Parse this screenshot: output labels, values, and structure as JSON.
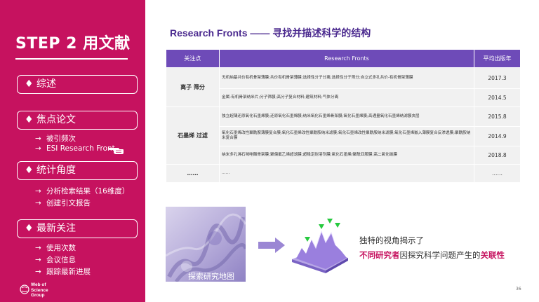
{
  "sidebar": {
    "title": "STEP 2  用文献",
    "sections": [
      {
        "label": "♦ 综述",
        "items": []
      },
      {
        "label": "♦ 焦点论文",
        "items": [
          "被引频次",
          "ESI Research Front"
        ]
      },
      {
        "label": "♦ 统计角度",
        "items": [
          "分析检索结果（16维度）",
          "创建引文报告"
        ]
      },
      {
        "label": "♦ 最新关注",
        "items": [
          "使用次数",
          "会议信息",
          "跟踪最新进展"
        ]
      }
    ],
    "arrow": "→",
    "pointer_icon": "hand-pointer-icon",
    "logo_lines": [
      "Web of",
      "Science",
      "Group"
    ]
  },
  "main": {
    "heading": "Research Fronts —— 寻找并描述科学的结构",
    "table": {
      "headers": [
        "关注点",
        "Research Fronts",
        "平均出版年"
      ],
      "groups": [
        {
          "focus": "离子 筛分",
          "fronts": [
            {
              "text": "无机纳基共价有机骨架薄膜;共价有机骨架薄膜;选择性分子分离;选择性分子筛分;自立式多孔共价-有机骨架薄膜",
              "year": "2017.3"
            },
            {
              "text": "金属-有机骨架纳米片;分子筛膜;高分子复合材料;建筑材料;气体分离",
              "year": "2014.5"
            }
          ]
        },
        {
          "focus": "石墨烯 过滤",
          "fronts": [
            {
              "text": "独立超薄还原氧化石墨烯膜;还原氧化石墨烯膜;纳米氧化石墨烯骨架膜;氧化石墨烯膜;高通量氧化石墨烯纳滤膜夹层",
              "year": "2015.8"
            },
            {
              "text": "氧化石墨烯改性聚酰胺薄膜复合膜;氧化石墨烯改性聚酰胺纳米滤膜;氧化石墨烯改性聚酰胺纳米滤膜;氧化石墨烯嵌入薄膜复合反渗透膜;聚酰胺纳米复合膜",
              "year": "2014.9"
            },
            {
              "text": "纳米多孔沸石咪唑酯骨架膜;聚偏氟乙烯超滤膜;超稳定耐溶剂膜;氧化石墨烯/聚酰亚胺膜;高二氧化碳膜",
              "year": "2018.8"
            }
          ]
        },
        {
          "focus": "……",
          "fronts": [
            {
              "text": "……",
              "year": "……"
            }
          ]
        }
      ]
    },
    "map_caption": "探索研究地图",
    "description_line1": "独特的视角揭示了",
    "description_line2": [
      {
        "text": "不同研究者",
        "highlight": true
      },
      {
        "text": "因探究科学问题产生的",
        "highlight": false
      },
      {
        "text": "关联性",
        "highlight": true
      }
    ],
    "page_number": "36",
    "colors": {
      "brand": "#c6125f",
      "header_purple": "#6e4bb8",
      "heading": "#4b2a8f",
      "cell_bg": "#f1f1f1"
    }
  }
}
